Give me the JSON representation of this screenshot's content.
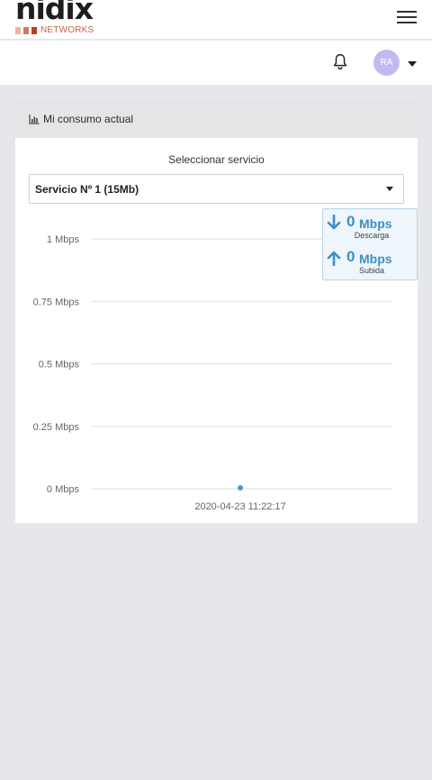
{
  "brand": {
    "name": "nidix",
    "tagline": "NETWORKS",
    "squares": [
      "#e7b69f",
      "#d37a5d",
      "#b6402c"
    ]
  },
  "header": {
    "menu_icon": "hamburger-icon",
    "notification_icon": "bell-icon",
    "user_initials": "RA",
    "avatar_color": "#c3b9f1"
  },
  "card": {
    "title": "Mi consumo actual",
    "title_icon": "area-chart-icon"
  },
  "service_select": {
    "label": "Seleccionar servicio",
    "value": "Servicio Nº 1 (15Mb)"
  },
  "speed": {
    "download_value": "0",
    "download_unit": "Mbps",
    "download_label": "Descarga",
    "upload_value": "0",
    "upload_unit": "Mbps",
    "upload_label": "Subida",
    "accent": "#3f8fc5"
  },
  "chart_data": {
    "type": "line",
    "x": [
      "2020-04-23 11:22:17"
    ],
    "y": [
      0
    ],
    "y_ticks": [
      "1 Mbps",
      "0.75 Mbps",
      "0.5 Mbps",
      "0.25 Mbps",
      "0 Mbps"
    ],
    "y_tick_values": [
      1,
      0.75,
      0.5,
      0.25,
      0
    ],
    "x_tick_labels": [
      "2020-04-23 11:22:17"
    ],
    "ylim": [
      0,
      1
    ],
    "grid": true,
    "point_color": "#4a9acd"
  }
}
